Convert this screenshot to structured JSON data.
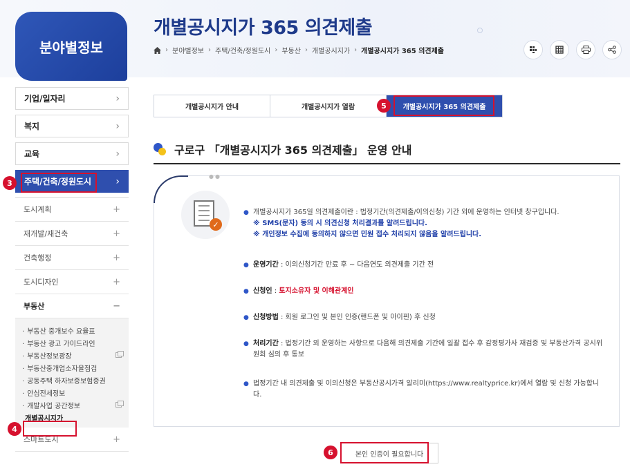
{
  "sidebar": {
    "title": "분야별정보",
    "menu": [
      {
        "label": "기업/일자리",
        "chev": "›"
      },
      {
        "label": "복지",
        "chev": "›"
      },
      {
        "label": "교육",
        "chev": "›"
      },
      {
        "label": "주택/건축/정원도시",
        "chev": "›"
      }
    ],
    "sub": [
      {
        "label": "도시계획",
        "sign": "+"
      },
      {
        "label": "재개발/재건축",
        "sign": "+"
      },
      {
        "label": "건축행정",
        "sign": "+"
      },
      {
        "label": "도시디자인",
        "sign": "+"
      },
      {
        "label": "부동산",
        "sign": "−"
      }
    ],
    "third": [
      {
        "label": "부동산 중개보수 요율표"
      },
      {
        "label": "부동산 광고 가이드라인"
      },
      {
        "label": "부동산정보광장"
      },
      {
        "label": "부동산중개업소자율점검"
      },
      {
        "label": "공동주택 하자보증보험증권"
      },
      {
        "label": "안심전세정보"
      },
      {
        "label": "개발사업 공간정보"
      },
      {
        "label": "개별공시지가"
      }
    ],
    "after": [
      {
        "label": "스마트도시",
        "sign": "+"
      }
    ]
  },
  "header": {
    "title": "개별공시지가 365 의견제출",
    "breadcrumb": [
      "분야별정보",
      "주택/건축/정원도시",
      "부동산",
      "개별공시지가",
      "개별공시지가 365 의견제출"
    ],
    "util_icons": [
      "sitemap-icon",
      "grid-icon",
      "print-icon",
      "share-icon"
    ]
  },
  "tabs": [
    "개별공시지가 안내",
    "개별공시지가 열람",
    "개별공시지가 365 의견제출"
  ],
  "section_title": "구로구 「개별공시지가 365 의견제출」 운영 안내",
  "bullets": {
    "b1": "개별공시지가 365일 의견제출이란 : 법정기간(의견제출/이의신청) 기간 외에 운영하는 인터넷 창구입니다.",
    "b1_note1": "※ SMS(문자) 동의 시 의견신청 처리결과를 알려드립니다.",
    "b1_note2": "※ 개인정보 수집에 동의하지 않으면 민원 접수 처리되지 않음을 알려드립니다.",
    "b2_label": "운영기간",
    "b2_text": " : 이의신청기간 만료 후 ~ 다음연도 의견제출 기간 전",
    "b3_label": "신청인",
    "b3_sep": " : ",
    "b3_text": "토지소유자 및 이해관계인",
    "b4_label": "신청방법",
    "b4_text": " : 회원 로그인 및 본인 인증(핸드폰 및 아이핀) 후 신청",
    "b5_label": "처리기간",
    "b5_text": " : 법정기간 외 운영하는 사항으로 다음해 의견제출 기간에 일괄 접수 후 감정평가사 재검증 및 부동산가격 공시위원회 심의 후 통보",
    "b6_text": "법정기간 내 의견제출 및 이의신청은 부동산공시가격 알리미(https://www.realtyprice.kr)에서 열람 및 신청 가능합니다."
  },
  "auth_button": "본인 인증이 필요합니다",
  "callouts": [
    "3",
    "4",
    "5",
    "6"
  ],
  "colors": {
    "primary": "#2f4fae",
    "accent_red": "#d6112e",
    "title_blue": "#1e3a8a"
  }
}
